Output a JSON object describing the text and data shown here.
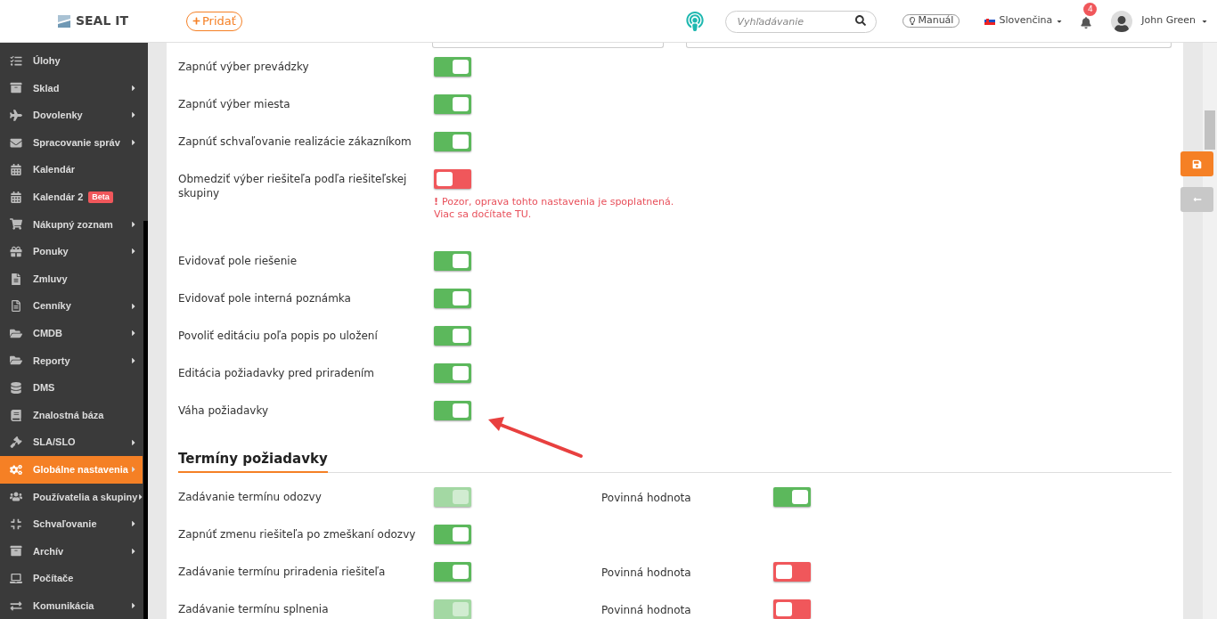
{
  "header": {
    "logo": "SEAL IT",
    "add_button": "Pridať",
    "search": {
      "placeholder": "Vyhľadávanie"
    },
    "manual_button": "Manuál",
    "language": "Slovenčina",
    "notifications": "4",
    "user": "John Green"
  },
  "sidebar": {
    "items": [
      {
        "label": "Úlohy",
        "submenu": false,
        "selected": false
      },
      {
        "label": "Sklad",
        "submenu": true,
        "selected": false
      },
      {
        "label": "Dovolenky",
        "submenu": true,
        "selected": false
      },
      {
        "label": "Spracovanie správ",
        "submenu": true,
        "selected": false
      },
      {
        "label": "Kalendár",
        "submenu": false,
        "selected": false
      },
      {
        "label": "Kalendár 2",
        "submenu": false,
        "selected": false,
        "badge": "Beta"
      },
      {
        "label": "Nákupný zoznam",
        "submenu": true,
        "selected": false
      },
      {
        "label": "Ponuky",
        "submenu": true,
        "selected": false
      },
      {
        "label": "Zmluvy",
        "submenu": false,
        "selected": false
      },
      {
        "label": "Cenníky",
        "submenu": true,
        "selected": false
      },
      {
        "label": "CMDB",
        "submenu": true,
        "selected": false
      },
      {
        "label": "Reporty",
        "submenu": true,
        "selected": false
      },
      {
        "label": "DMS",
        "submenu": false,
        "selected": false
      },
      {
        "label": "Znalostná báza",
        "submenu": false,
        "selected": false
      },
      {
        "label": "SLA/SLO",
        "submenu": true,
        "selected": false
      },
      {
        "label": "Globálne nastavenia",
        "submenu": true,
        "selected": true
      },
      {
        "label": "Používatelia a skupiny",
        "submenu": true,
        "selected": false
      },
      {
        "label": "Schvaľovanie",
        "submenu": true,
        "selected": false
      },
      {
        "label": "Archív",
        "submenu": true,
        "selected": false
      },
      {
        "label": "Počítače",
        "submenu": false,
        "selected": false
      },
      {
        "label": "Komunikácia",
        "submenu": true,
        "selected": false
      }
    ]
  },
  "settings": [
    {
      "label": "Zapnúť výber prevádzky",
      "on": true,
      "disabled": false
    },
    {
      "label": "Zapnúť výber miesta",
      "on": true,
      "disabled": false
    },
    {
      "label": "Zapnúť schvaľovanie realizácie zákazníkom",
      "on": true,
      "disabled": false
    },
    {
      "label": "Obmedziť výber riešiteľa podľa riešiteľskej skupiny",
      "on": false,
      "disabled": false,
      "warning": {
        "mark": "!",
        "text": "Pozor, oprava tohto nastavenia je spoplatnená. Viac sa dočítate ",
        "link": "TU",
        "end": "."
      }
    },
    {
      "label": "Evidovať pole riešenie",
      "on": true,
      "disabled": false
    },
    {
      "label": "Evidovať pole interná poznámka",
      "on": true,
      "disabled": false
    },
    {
      "label": "Povoliť editáciu poľa popis po uložení",
      "on": true,
      "disabled": false
    },
    {
      "label": "Editácia požiadavky pred priradením",
      "on": true,
      "disabled": false
    },
    {
      "label": "Váha požiadavky",
      "on": true,
      "disabled": false
    }
  ],
  "deadlines": {
    "title": "Termíny požiadavky",
    "rows": [
      {
        "label": "Zadávanie termínu odozvy",
        "on": true,
        "disabled": true,
        "required": {
          "label": "Povinná hodnota",
          "on": true
        }
      },
      {
        "label": "Zapnúť zmenu riešiteľa po zmeškaní odozvy",
        "on": true,
        "disabled": false
      },
      {
        "label": "Zadávanie termínu priradenia riešiteľa",
        "on": true,
        "disabled": false,
        "required": {
          "label": "Povinná hodnota",
          "on": false
        }
      },
      {
        "label": "Zadávanie termínu splnenia",
        "on": true,
        "disabled": true,
        "required": {
          "label": "Povinná hodnota",
          "on": false
        }
      }
    ]
  }
}
